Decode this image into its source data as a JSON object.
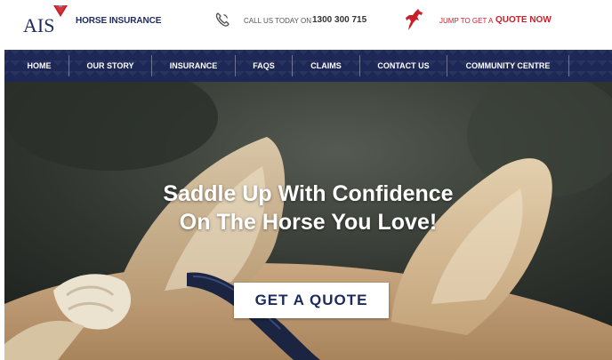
{
  "header": {
    "logo_text": "AIS",
    "brand_name": "HORSE INSURANCE",
    "call_label": "CALL US TODAY ON",
    "phone_number": "1300 300 715",
    "jump_label": "JUMP TO GET A",
    "quote_link": "QUOTE NOW",
    "icons": {
      "phone": "phone-icon",
      "horse": "horse-icon"
    }
  },
  "nav": {
    "items": [
      {
        "label": "HOME"
      },
      {
        "label": "OUR STORY"
      },
      {
        "label": "INSURANCE"
      },
      {
        "label": "FAQS"
      },
      {
        "label": "CLAIMS"
      },
      {
        "label": "CONTACT US"
      },
      {
        "label": "COMMUNITY CENTRE"
      }
    ]
  },
  "hero": {
    "headline_line1": "Saddle Up With Confidence",
    "headline_line2": "On The Horse You Love!",
    "cta_label": "GET A QUOTE"
  },
  "colors": {
    "navy": "#1c2a5e",
    "nav_background": "#1d2856",
    "accent_red": "#c81f2b",
    "white": "#ffffff"
  }
}
